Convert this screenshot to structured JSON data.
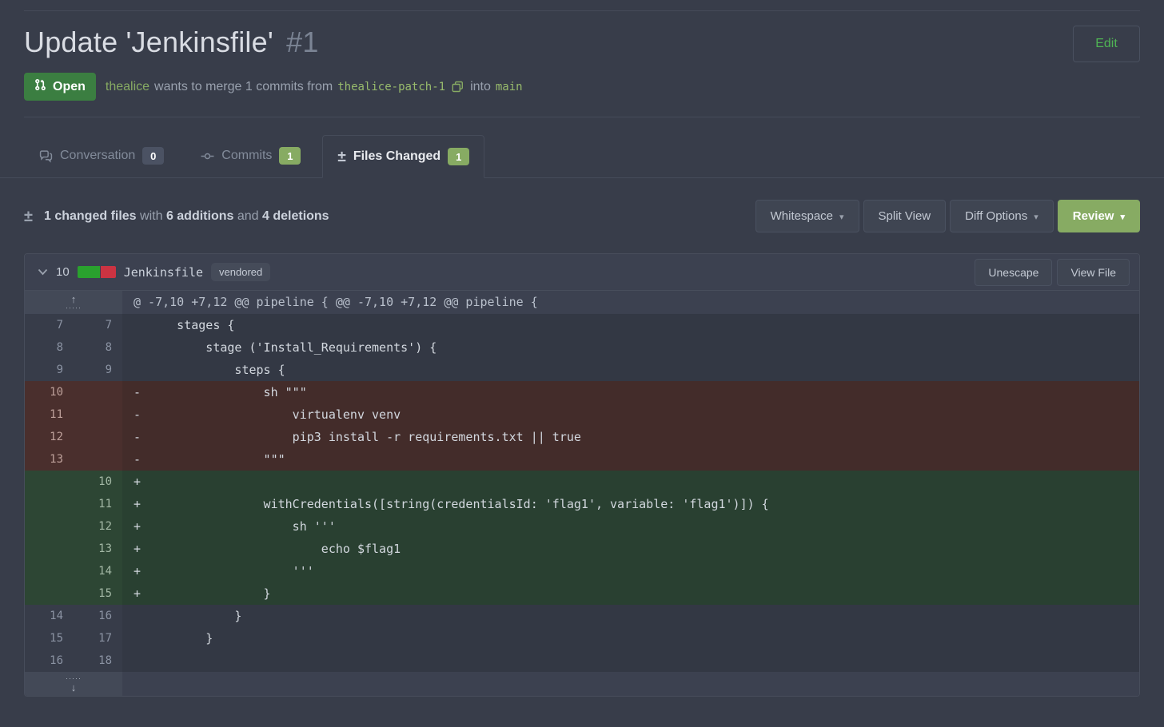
{
  "colors": {
    "page_bg": "#383d4a",
    "green_accent": "#87ab63",
    "open_badge_green": "#3b7e41",
    "edit_green": "#4fb454",
    "added_row_bg": "#294031",
    "removed_row_bg": "#432c2a",
    "diffstat_green": "#2aa12e",
    "diffstat_red": "#cc3342"
  },
  "header": {
    "title": "Update 'Jenkinsfile'",
    "issue_number": "#1",
    "edit_button": "Edit",
    "state_label": "Open",
    "author": "thealice",
    "action_text": "wants to merge 1 commits from",
    "source_branch": "thealice-patch-1",
    "into_text": "into",
    "target_branch": "main"
  },
  "tabs": [
    {
      "id": "conversation",
      "label": "Conversation",
      "count": "0",
      "badge": "gray",
      "icon": "chat-icon",
      "active": false
    },
    {
      "id": "commits",
      "label": "Commits",
      "count": "1",
      "badge": "green",
      "icon": "commit-icon",
      "active": false
    },
    {
      "id": "files-changed",
      "label": "Files Changed",
      "count": "1",
      "badge": "green",
      "icon": "diff-icon",
      "active": true
    }
  ],
  "toolbar": {
    "summary": {
      "files_bold": "1 changed files",
      "with_text": "with",
      "additions_bold": "6 additions",
      "and_text": "and",
      "deletions_bold": "4 deletions"
    },
    "buttons": [
      {
        "label": "Whitespace",
        "caret": true
      },
      {
        "label": "Split View",
        "caret": false
      },
      {
        "label": "Diff Options",
        "caret": true
      }
    ],
    "review": {
      "label": "Review",
      "caret": true
    }
  },
  "file": {
    "changes_count": "10",
    "stat_additions": 6,
    "stat_deletions": 4,
    "name": "Jenkinsfile",
    "tag": "vendored",
    "buttons": [
      "Unescape",
      "View File"
    ]
  },
  "diff": {
    "hunk_text": "@ -7,10 +7,12 @@ pipeline { @@ -7,10 +7,12 @@ pipeline {",
    "rows": [
      {
        "type": "ctx",
        "old": "7",
        "new": "7",
        "marker": " ",
        "code": "    stages {"
      },
      {
        "type": "ctx",
        "old": "8",
        "new": "8",
        "marker": " ",
        "code": "        stage ('Install_Requirements') {"
      },
      {
        "type": "ctx",
        "old": "9",
        "new": "9",
        "marker": " ",
        "code": "            steps {"
      },
      {
        "type": "del",
        "old": "10",
        "new": "",
        "marker": "-",
        "code": "                sh \"\"\""
      },
      {
        "type": "del",
        "old": "11",
        "new": "",
        "marker": "-",
        "code": "                    virtualenv venv"
      },
      {
        "type": "del",
        "old": "12",
        "new": "",
        "marker": "-",
        "code": "                    pip3 install -r requirements.txt || true"
      },
      {
        "type": "del",
        "old": "13",
        "new": "",
        "marker": "-",
        "code": "                \"\"\""
      },
      {
        "type": "add",
        "old": "",
        "new": "10",
        "marker": "+",
        "code": ""
      },
      {
        "type": "add",
        "old": "",
        "new": "11",
        "marker": "+",
        "code": "                withCredentials([string(credentialsId: 'flag1', variable: 'flag1')]) {"
      },
      {
        "type": "add",
        "old": "",
        "new": "12",
        "marker": "+",
        "code": "                    sh '''"
      },
      {
        "type": "add",
        "old": "",
        "new": "13",
        "marker": "+",
        "code": "                        echo $flag1"
      },
      {
        "type": "add",
        "old": "",
        "new": "14",
        "marker": "+",
        "code": "                    '''"
      },
      {
        "type": "add",
        "old": "",
        "new": "15",
        "marker": "+",
        "code": "                }"
      },
      {
        "type": "ctx",
        "old": "14",
        "new": "16",
        "marker": " ",
        "code": "            }"
      },
      {
        "type": "ctx",
        "old": "15",
        "new": "17",
        "marker": " ",
        "code": "        }"
      },
      {
        "type": "ctx",
        "old": "16",
        "new": "18",
        "marker": " ",
        "code": ""
      }
    ]
  }
}
